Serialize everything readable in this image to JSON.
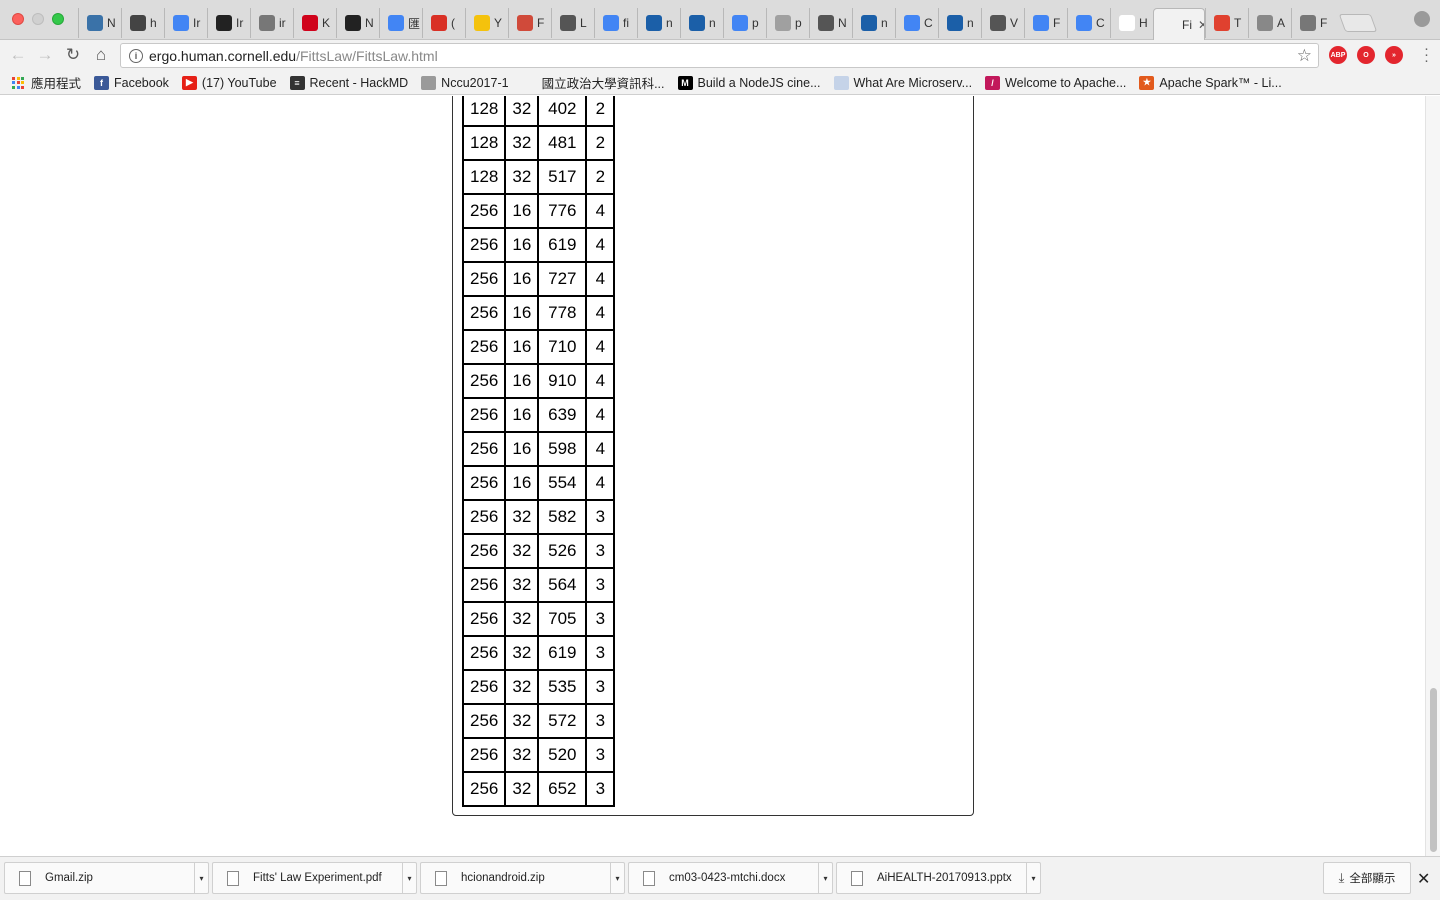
{
  "browser": {
    "tabs": [
      {
        "label": "N",
        "icon": "python-icon",
        "color": "#3a72a8"
      },
      {
        "label": "h",
        "icon": "document-icon",
        "color": "#444444"
      },
      {
        "label": "Ir",
        "icon": "infinity-icon",
        "color": "#4285f4"
      },
      {
        "label": "Ir",
        "icon": "document-icon",
        "color": "#222222"
      },
      {
        "label": "ir",
        "icon": "circle-icon",
        "color": "#777777"
      },
      {
        "label": "K",
        "icon": "k-icon",
        "color": "#d0021b"
      },
      {
        "label": "N",
        "icon": "github-icon",
        "color": "#222222"
      },
      {
        "label": "匯",
        "icon": "google-icon",
        "color": "#4285f4"
      },
      {
        "label": "(",
        "icon": "gmail-icon",
        "color": "#d93025"
      },
      {
        "label": "Y",
        "icon": "yellow-square-icon",
        "color": "#f4c20d"
      },
      {
        "label": "F",
        "icon": "translate-icon",
        "color": "#d04a3a"
      },
      {
        "label": "L",
        "icon": "wikipedia-icon",
        "color": "#555555"
      },
      {
        "label": "fi",
        "icon": "google-icon",
        "color": "#4285f4"
      },
      {
        "label": "n",
        "icon": "stackshare-icon",
        "color": "#1b5fa8"
      },
      {
        "label": "n",
        "icon": "stackshare-icon",
        "color": "#1b5fa8"
      },
      {
        "label": "p",
        "icon": "google-icon",
        "color": "#4285f4"
      },
      {
        "label": "p",
        "icon": "globe-icon",
        "color": "#a0a0a0"
      },
      {
        "label": "N",
        "icon": "wikipedia-icon",
        "color": "#555555"
      },
      {
        "label": "n",
        "icon": "stackshare-icon",
        "color": "#1b5fa8"
      },
      {
        "label": "C",
        "icon": "google-translate-icon",
        "color": "#4285f4"
      },
      {
        "label": "n",
        "icon": "stackshare-icon",
        "color": "#1b5fa8"
      },
      {
        "label": "V",
        "icon": "wikipedia-icon",
        "color": "#555555"
      },
      {
        "label": "F",
        "icon": "loading-icon",
        "color": "#4285f4"
      },
      {
        "label": "C",
        "icon": "google-icon",
        "color": "#4285f4"
      },
      {
        "label": "H",
        "icon": "blank-page-icon",
        "color": "#ffffff"
      },
      {
        "label": "Fi",
        "icon": "blank-icon",
        "color": "#f2f2f2",
        "active": true,
        "close": "✕"
      },
      {
        "label": "T",
        "icon": "layers-icon",
        "color": "#e0412f"
      },
      {
        "label": "A",
        "icon": "page-icon",
        "color": "#888888"
      },
      {
        "label": "F",
        "icon": "gear-icon",
        "color": "#777777"
      }
    ],
    "url_host": "ergo.human.cornell.edu",
    "url_path": "/FittsLaw/FittsLaw.html",
    "extensions": [
      {
        "name": "adblock-icon",
        "label": "ABP",
        "color": "#e3262e"
      },
      {
        "name": "opera-icon",
        "label": "O",
        "color": "#e3262e"
      },
      {
        "name": "media-icon",
        "label": "»",
        "color": "#e3262e"
      }
    ],
    "bookmarks": [
      {
        "label": "應用程式",
        "icon": "apps-grid-icon"
      },
      {
        "label": "Facebook",
        "icon": "facebook-icon",
        "color": "#3b5998",
        "glyph": "f"
      },
      {
        "label": "(17) YouTube",
        "icon": "youtube-icon",
        "color": "#e62117",
        "glyph": "▶"
      },
      {
        "label": "Recent - HackMD",
        "icon": "hackmd-icon",
        "color": "#333333",
        "glyph": "≡"
      },
      {
        "label": "Nccu2017-1",
        "icon": "folder-icon",
        "color": "#9a9a9a",
        "glyph": ""
      },
      {
        "label": "國立政治大學資訊科...",
        "icon": "nccu-icon",
        "color": "#f2f2f2",
        "glyph": ""
      },
      {
        "label": "Build a NodeJS cine...",
        "icon": "medium-icon",
        "color": "#000000",
        "glyph": "M"
      },
      {
        "label": "What Are Microserv...",
        "icon": "page-icon",
        "color": "#c5d3e8",
        "glyph": ""
      },
      {
        "label": "Welcome to Apache...",
        "icon": "apache-feather-icon",
        "color": "#c2185b",
        "glyph": "/"
      },
      {
        "label": "Apache Spark™ - Li...",
        "icon": "spark-icon",
        "color": "#e25a1c",
        "glyph": "★"
      }
    ]
  },
  "table": {
    "rows": [
      [
        "128",
        "32",
        "402",
        "2"
      ],
      [
        "128",
        "32",
        "481",
        "2"
      ],
      [
        "128",
        "32",
        "517",
        "2"
      ],
      [
        "256",
        "16",
        "776",
        "4"
      ],
      [
        "256",
        "16",
        "619",
        "4"
      ],
      [
        "256",
        "16",
        "727",
        "4"
      ],
      [
        "256",
        "16",
        "778",
        "4"
      ],
      [
        "256",
        "16",
        "710",
        "4"
      ],
      [
        "256",
        "16",
        "910",
        "4"
      ],
      [
        "256",
        "16",
        "639",
        "4"
      ],
      [
        "256",
        "16",
        "598",
        "4"
      ],
      [
        "256",
        "16",
        "554",
        "4"
      ],
      [
        "256",
        "32",
        "582",
        "3"
      ],
      [
        "256",
        "32",
        "526",
        "3"
      ],
      [
        "256",
        "32",
        "564",
        "3"
      ],
      [
        "256",
        "32",
        "705",
        "3"
      ],
      [
        "256",
        "32",
        "619",
        "3"
      ],
      [
        "256",
        "32",
        "535",
        "3"
      ],
      [
        "256",
        "32",
        "572",
        "3"
      ],
      [
        "256",
        "32",
        "520",
        "3"
      ],
      [
        "256",
        "32",
        "652",
        "3"
      ]
    ]
  },
  "downloads": {
    "items": [
      {
        "name": "Gmail.zip"
      },
      {
        "name": "Fitts' Law Experiment.pdf"
      },
      {
        "name": "hcionandroid.zip"
      },
      {
        "name": "cm03-0423-mtchi.docx"
      },
      {
        "name": "AiHEALTH-20170913.pptx"
      }
    ],
    "show_all": "全部顯示",
    "close": "✕"
  }
}
